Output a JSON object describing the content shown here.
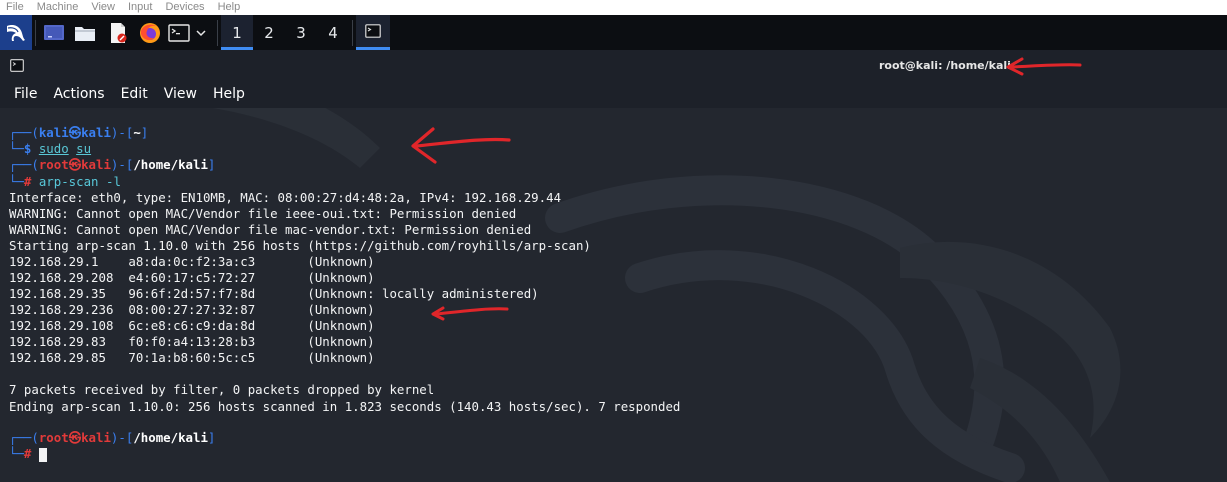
{
  "vm_menu": [
    "File",
    "Machine",
    "View",
    "Input",
    "Devices",
    "Help"
  ],
  "panel": {
    "workspaces": [
      "1",
      "2",
      "3",
      "4"
    ],
    "active_workspace": "1",
    "icons": [
      "kali-menu-icon",
      "desktop-icon",
      "file-manager-icon",
      "text-editor-icon",
      "firefox-icon",
      "terminal-icon",
      "chevron-down-icon"
    ],
    "accent": "#3f8cf3"
  },
  "window": {
    "title": "root@kali: /home/kali"
  },
  "terminal_menu": [
    "File",
    "Actions",
    "Edit",
    "View",
    "Help"
  ],
  "prompt1": {
    "user": "kali",
    "at": "㉿",
    "host": "kali",
    "path": "~",
    "cmd_a": "sudo",
    "cmd_b": "su"
  },
  "prompt2": {
    "user": "root",
    "at": "㉿",
    "host": "kali",
    "path": "/home/kali",
    "cmd": "arp-scan -l"
  },
  "output": [
    "Interface: eth0, type: EN10MB, MAC: 08:00:27:d4:48:2a, IPv4: 192.168.29.44",
    "WARNING: Cannot open MAC/Vendor file ieee-oui.txt: Permission denied",
    "WARNING: Cannot open MAC/Vendor file mac-vendor.txt: Permission denied",
    "Starting arp-scan 1.10.0 with 256 hosts (https://github.com/royhills/arp-scan)"
  ],
  "hosts": [
    {
      "ip": "192.168.29.1",
      "mac": "a8:da:0c:f2:3a:c3",
      "vendor": "(Unknown)"
    },
    {
      "ip": "192.168.29.208",
      "mac": "e4:60:17:c5:72:27",
      "vendor": "(Unknown)"
    },
    {
      "ip": "192.168.29.35",
      "mac": "96:6f:2d:57:f7:8d",
      "vendor": "(Unknown: locally administered)"
    },
    {
      "ip": "192.168.29.236",
      "mac": "08:00:27:27:32:87",
      "vendor": "(Unknown)"
    },
    {
      "ip": "192.168.29.108",
      "mac": "6c:e8:c6:c9:da:8d",
      "vendor": "(Unknown)"
    },
    {
      "ip": "192.168.29.83",
      "mac": "f0:f0:a4:13:28:b3",
      "vendor": "(Unknown)"
    },
    {
      "ip": "192.168.29.85",
      "mac": "70:1a:b8:60:5c:c5",
      "vendor": "(Unknown)"
    }
  ],
  "summary": [
    "7 packets received by filter, 0 packets dropped by kernel",
    "Ending arp-scan 1.10.0: 256 hosts scanned in 1.823 seconds (140.43 hosts/sec). 7 responded"
  ],
  "prompt3": {
    "user": "root",
    "at": "㉿",
    "host": "kali",
    "path": "/home/kali"
  },
  "colors": {
    "prompt_blue": "#3a7ff0",
    "root_red": "#e23a3a",
    "annotation_red": "#e0262a",
    "terminal_bg": "#23272f"
  }
}
